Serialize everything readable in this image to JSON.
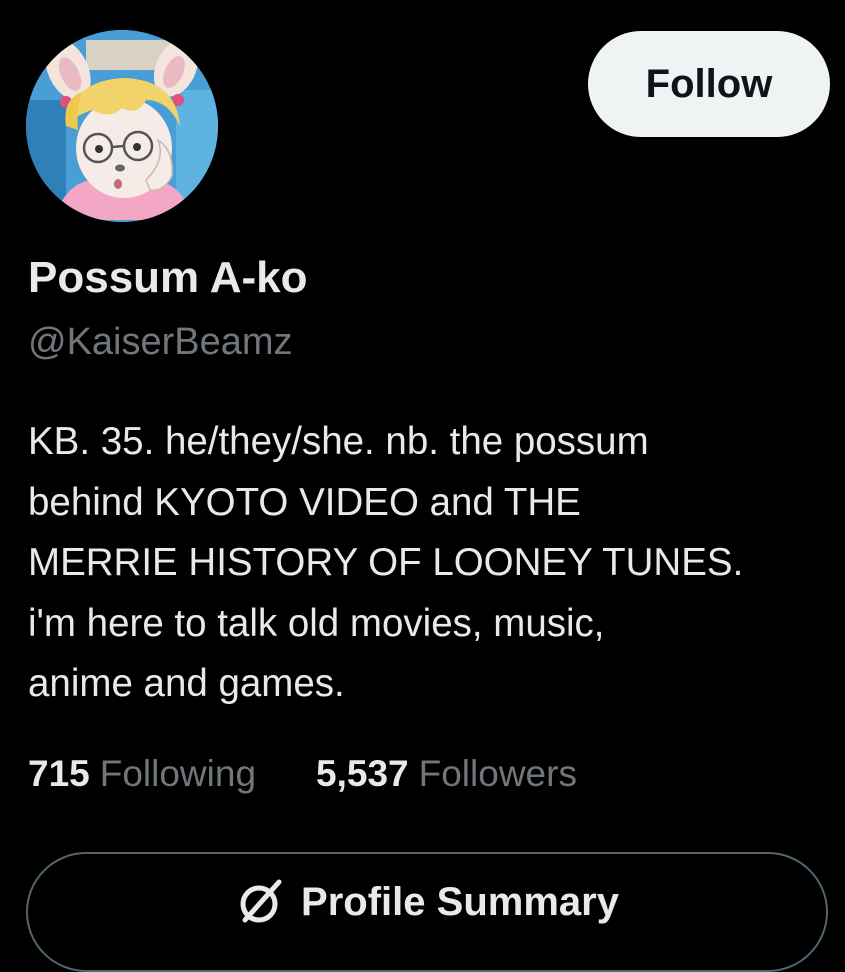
{
  "profile": {
    "display_name": "Possum A-ko",
    "handle": "@KaiserBeamz",
    "avatar_icon": "avatar-cartoon-possum-icon",
    "bio_lines": [
      "KB. 35. he/they/she. nb. the possum",
      "behind KYOTO VIDEO and THE",
      "MERRIE HISTORY OF LOONEY TUNES.",
      "i'm here to talk old movies, music,",
      "anime and games."
    ]
  },
  "actions": {
    "follow_label": "Follow",
    "summary_label": "Profile Summary",
    "summary_icon": "grok-slash-circle-icon"
  },
  "stats": {
    "following_count": "715",
    "following_label": "Following",
    "followers_count": "5,537",
    "followers_label": "Followers"
  },
  "colors": {
    "background": "#000000",
    "primary_text": "#e7e9ea",
    "secondary_text": "#71767b",
    "follow_button_bg": "#eff3f4",
    "follow_button_text": "#0f1419",
    "outline": "#536471"
  }
}
